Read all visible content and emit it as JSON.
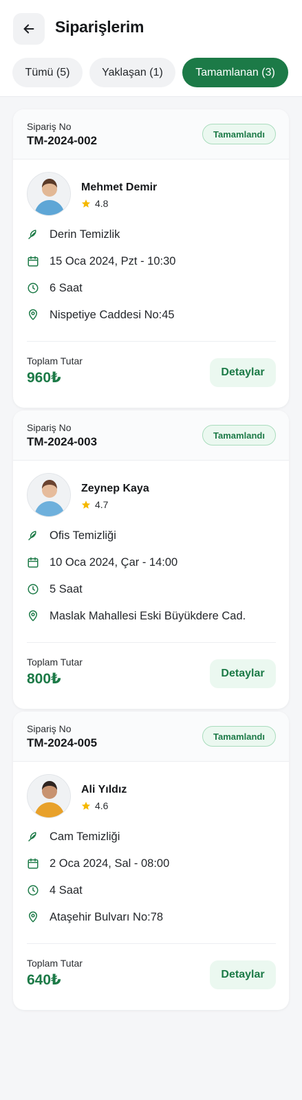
{
  "header": {
    "title": "Siparişlerim",
    "back_icon": "arrow-left-icon"
  },
  "tabs": [
    {
      "label": "Tümü (5)",
      "active": false
    },
    {
      "label": "Yaklaşan (1)",
      "active": false
    },
    {
      "label": "Tamamlanan (3)",
      "active": true
    }
  ],
  "colors": {
    "accent": "#1c7a47",
    "badge_bg": "#ebf8f0",
    "star": "#f5b800",
    "background": "#f5f6f8"
  },
  "orders": [
    {
      "order_label": "Sipariş No",
      "order_no": "TM-2024-002",
      "status": "Tamamlandı",
      "worker_name": "Mehmet Demir",
      "rating": "4.8",
      "service": "Derin Temizlik",
      "date": "15 Oca 2024, Pzt - 10:30",
      "duration": "6 Saat",
      "address": "Nispetiye Caddesi No:45",
      "total_label": "Toplam Tutar",
      "total": "960₺",
      "details_label": "Detaylar"
    },
    {
      "order_label": "Sipariş No",
      "order_no": "TM-2024-003",
      "status": "Tamamlandı",
      "worker_name": "Zeynep Kaya",
      "rating": "4.7",
      "service": "Ofis Temizliği",
      "date": "10 Oca 2024, Çar - 14:00",
      "duration": "5 Saat",
      "address": "Maslak Mahallesi Eski Büyükdere Cad.",
      "total_label": "Toplam Tutar",
      "total": "800₺",
      "details_label": "Detaylar"
    },
    {
      "order_label": "Sipariş No",
      "order_no": "TM-2024-005",
      "status": "Tamamlandı",
      "worker_name": "Ali Yıldız",
      "rating": "4.6",
      "service": "Cam Temizliği",
      "date": "2 Oca 2024, Sal - 08:00",
      "duration": "4 Saat",
      "address": "Ataşehir Bulvarı No:78",
      "total_label": "Toplam Tutar",
      "total": "640₺",
      "details_label": "Detaylar"
    }
  ]
}
